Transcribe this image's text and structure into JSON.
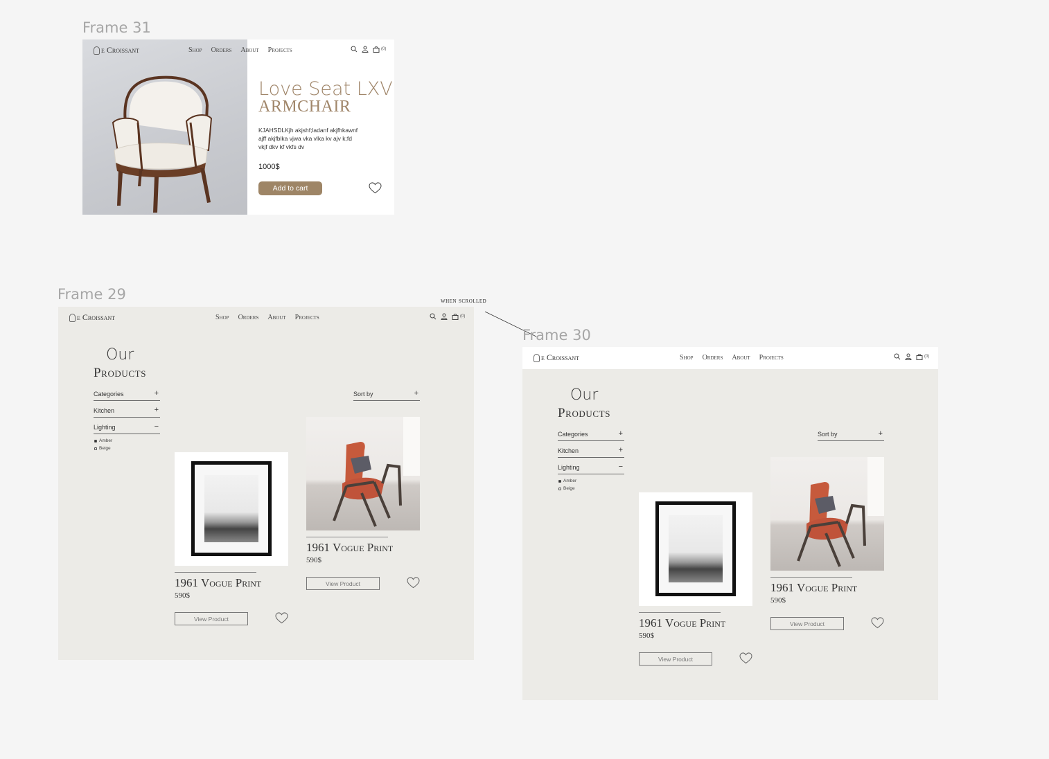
{
  "frames": {
    "f31": "Frame 31",
    "f29": "Frame 29",
    "f30": "Frame 30"
  },
  "annotation": "when scrolled",
  "nav": {
    "logo": "e Croissant",
    "links": [
      "Shop",
      "Orders",
      "About",
      "Projects"
    ],
    "cart_count": "(0)",
    "icons": [
      "search-icon",
      "user-icon",
      "cart-icon"
    ]
  },
  "product_detail": {
    "title": "Love Seat LXV",
    "subtitle": "ARMCHAIR",
    "description": "KJAHSDLKjh akjshf;ladanf akjfhkawnf ajff akjfblka vjwa vka vlka kv ajv k;fd vkjf dkv kf vkfs dv",
    "price": "1000$",
    "add_to_cart": "Add to cart"
  },
  "listing": {
    "heading_line1": "Our",
    "heading_line2": "Products",
    "filters": [
      {
        "label": "Categories",
        "symbol": "+"
      },
      {
        "label": "Kitchen",
        "symbol": "+"
      },
      {
        "label": "Lighting",
        "symbol": "−"
      }
    ],
    "checkboxes": [
      {
        "label": "Amber",
        "checked": true
      },
      {
        "label": "Beige",
        "checked": false
      }
    ],
    "sort_label": "Sort by",
    "sort_symbol": "+",
    "products": [
      {
        "title": "1961 Vogue Print",
        "price": "590$",
        "button": "View Product"
      },
      {
        "title": "1961 Vogue Print",
        "price": "590$",
        "button": "View Product"
      }
    ]
  },
  "colors": {
    "accent": "#9e8566",
    "title_accent": "#a0866a",
    "listing_bg": "#ecebe7",
    "canvas_bg": "#f5f5f5"
  }
}
